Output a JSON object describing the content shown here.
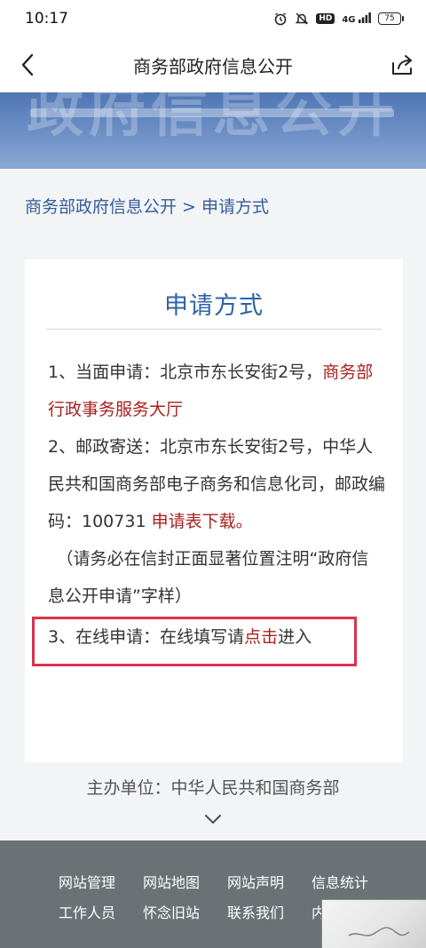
{
  "status_bar": {
    "time": "10:17",
    "icons": [
      "alarm-icon",
      "bell-off-icon",
      "hd-icon",
      "signal-4g-icon",
      "battery-icon"
    ],
    "hd_label": "HD",
    "signal_label": "4G",
    "battery_level": "75"
  },
  "navbar": {
    "title": "商务部政府信息公开"
  },
  "banner": {
    "ghost_text": "政府信息公开"
  },
  "breadcrumb": {
    "root": "商务部政府信息公开",
    "separator": ">",
    "current": "申请方式"
  },
  "card": {
    "heading": "申请方式",
    "item1_prefix": "1、当面申请：北京市东长安街2号，",
    "item1_link": "商务部行政事务服务大厅",
    "item2_prefix": "2、邮政寄送：北京市东长安街2号，中华人民共和国商务部电子商务和信息化司，邮政编码：100731 ",
    "item2_link": "申请表下载。",
    "note": "（请务必在信封正面显著位置注明“政府信息公开申请”字样）",
    "item3_prefix": "3、在线申请：在线填写请",
    "item3_link": "点击",
    "item3_suffix": "进入"
  },
  "sponsor": {
    "text": "主办单位：中华人民共和国商务部"
  },
  "footer": {
    "row1": [
      "网站管理",
      "网站地图",
      "网站声明",
      "信息统计"
    ],
    "row2": [
      "工作人员",
      "怀念旧站",
      "联系我们",
      "内"
    ]
  },
  "colors": {
    "brand_blue": "#2e63a4",
    "link_red": "#a8211f",
    "highlight_red": "#d9334d",
    "footer_gray": "#6b7276"
  }
}
